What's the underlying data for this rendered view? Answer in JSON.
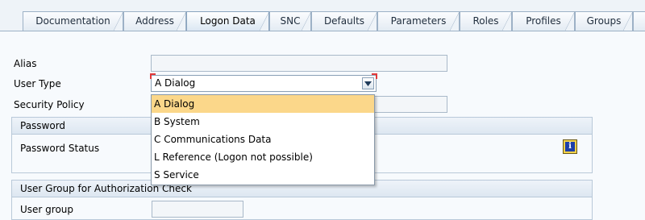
{
  "tabs": [
    {
      "label": "Documentation",
      "active": false
    },
    {
      "label": "Address",
      "active": false
    },
    {
      "label": "Logon Data",
      "active": true
    },
    {
      "label": "SNC",
      "active": false
    },
    {
      "label": "Defaults",
      "active": false
    },
    {
      "label": "Parameters",
      "active": false
    },
    {
      "label": "Roles",
      "active": false
    },
    {
      "label": "Profiles",
      "active": false
    },
    {
      "label": "Groups",
      "active": false
    }
  ],
  "form": {
    "alias_label": "Alias",
    "alias_value": "",
    "user_type_label": "User Type",
    "user_type_value": "A Dialog",
    "security_policy_label": "Security Policy",
    "security_policy_value": ""
  },
  "password_group": {
    "title": "Password",
    "status_label": "Password Status",
    "info_icon": "info-icon"
  },
  "user_group_box": {
    "title": "User Group for Authorization Check",
    "user_group_label": "User group"
  },
  "user_type_dropdown": {
    "options": [
      "A Dialog",
      "B System",
      "C Communications Data",
      "L Reference (Logon not possible)",
      "S Service"
    ],
    "selected": "A Dialog"
  },
  "colors": {
    "selected_option_bg": "#fbd78a",
    "info_button_bg": "#f3d24a",
    "required_marker": "#e23a3a"
  }
}
